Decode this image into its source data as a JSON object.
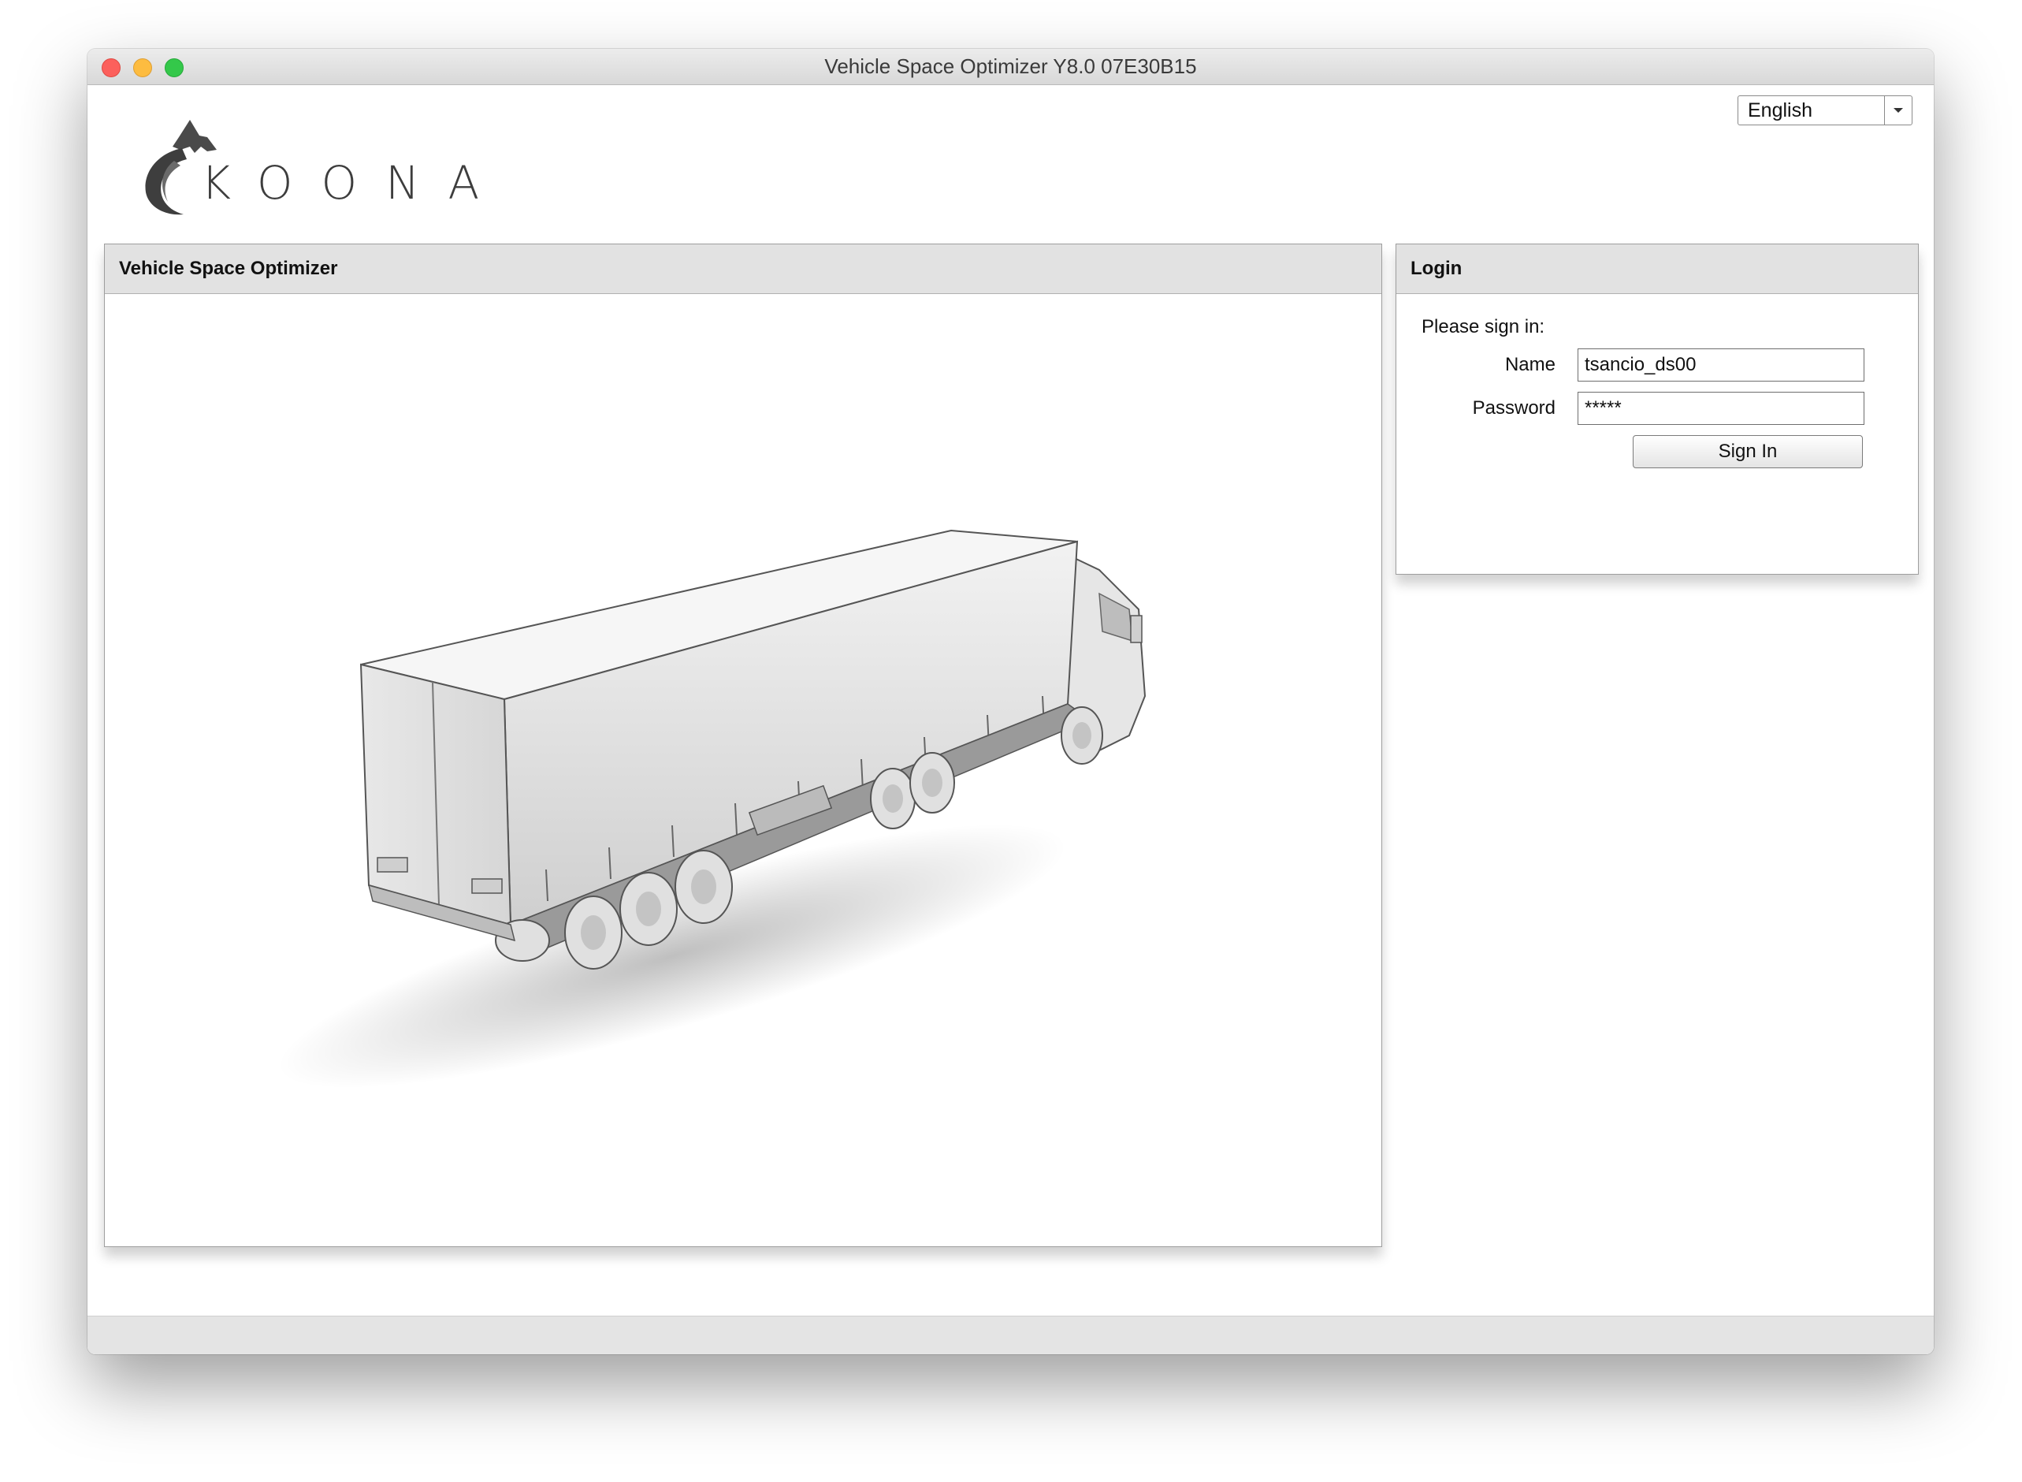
{
  "window": {
    "title": "Vehicle Space Optimizer Y8.0 07E30B15"
  },
  "brand": {
    "name": "KOONA"
  },
  "language": {
    "selected": "English"
  },
  "main_panel": {
    "title": "Vehicle Space Optimizer"
  },
  "login": {
    "title": "Login",
    "prompt": "Please sign in:",
    "name_label": "Name",
    "name_value": "tsancio_ds00",
    "password_label": "Password",
    "password_value": "*****",
    "signin_label": "Sign In"
  }
}
